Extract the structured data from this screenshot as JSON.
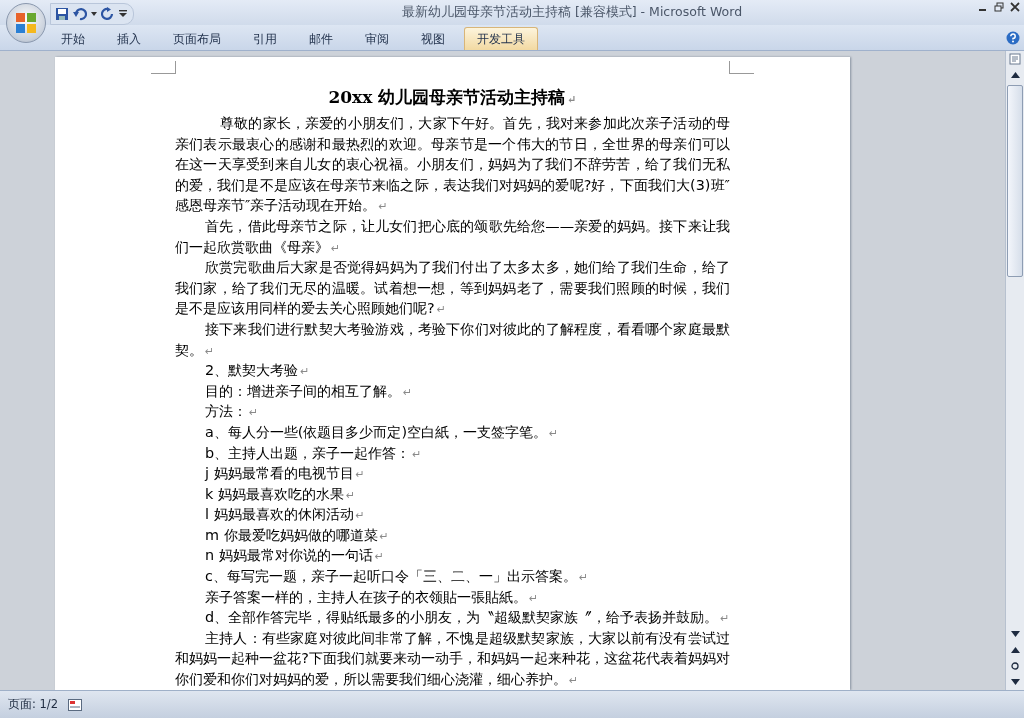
{
  "window": {
    "title": "最新幼儿园母亲节活动主持稿 [兼容模式] - Microsoft Word"
  },
  "tabs": [
    {
      "label": "开始",
      "selected": false
    },
    {
      "label": "插入",
      "selected": false
    },
    {
      "label": "页面布局",
      "selected": false
    },
    {
      "label": "引用",
      "selected": false
    },
    {
      "label": "邮件",
      "selected": false
    },
    {
      "label": "审阅",
      "selected": false
    },
    {
      "label": "视图",
      "selected": false
    },
    {
      "label": "开发工具",
      "selected": true
    }
  ],
  "document": {
    "title": "20xx 幼儿园母亲节活动主持稿",
    "paragraph_mark": "↵",
    "paragraphs": [
      {
        "kind": "body",
        "text": "尊敬的家长，亲爱的小朋友们，大家下午好。首先，我对来参加此次亲子活动的母亲们表示最衷心的感谢和最热烈的欢迎。母亲节是一个伟大的节日，全世界的母亲们可以在这一天享受到来自儿女的衷心祝福。小朋友们，妈妈为了我们不辞劳苦，给了我们无私的爱，我们是不是应该在母亲节来临之际，表达我们对妈妈的爱呢?好，下面我们大(3)班″感恩母亲节″亲子活动现在开始。",
        "first": true
      },
      {
        "kind": "body",
        "text": "首先，借此母亲节之际，让儿女们把心底的颂歌先给您——亲爱的妈妈。接下来让我们一起欣赏歌曲《母亲》"
      },
      {
        "kind": "body",
        "text": "欣赏完歌曲后大家是否觉得妈妈为了我们付出了太多太多，她们给了我们生命，给了我们家，给了我们无尽的温暖。试着想一想，等到妈妈老了，需要我们照顾的时候，我们是不是应该用同样的爱去关心照顾她们呢?"
      },
      {
        "kind": "body",
        "text": "接下来我们进行默契大考验游戏，考验下你们对彼此的了解程度，看看哪个家庭最默契。"
      },
      {
        "kind": "item",
        "text": "2、默契大考验"
      },
      {
        "kind": "item",
        "text": "目的：增进亲子间的相互了解。"
      },
      {
        "kind": "item",
        "text": "方法："
      },
      {
        "kind": "item",
        "text": "a、每人分一些(依题目多少而定)空白紙，一支签字笔。"
      },
      {
        "kind": "item",
        "text": "b、主持人出题，亲子一起作答："
      },
      {
        "kind": "item",
        "text": "j 妈妈最常看的电视节目"
      },
      {
        "kind": "item",
        "text": "k 妈妈最喜欢吃的水果"
      },
      {
        "kind": "item",
        "text": "l 妈妈最喜欢的休闲活动"
      },
      {
        "kind": "item",
        "text": "m 你最爱吃妈妈做的哪道菜"
      },
      {
        "kind": "item",
        "text": "n 妈妈最常对你说的一句话"
      },
      {
        "kind": "item",
        "text": "c、每写完一题，亲子一起听口令「三、二、一」出示答案。"
      },
      {
        "kind": "item",
        "text": "亲子答案一样的，主持人在孩子的衣领貼一張貼紙。"
      },
      {
        "kind": "item",
        "text": "d、全部作答完毕，得贴纸最多的小朋友，为〝超級默契家族〞，给予表扬并鼓励。"
      },
      {
        "kind": "body",
        "text": "主持人：有些家庭对彼此间非常了解，不愧是超级默契家族，大家以前有没有尝试过和妈妈一起种一盆花?下面我们就要来动一动手，和妈妈一起来种花，这盆花代表着妈妈对你们爱和你们对妈妈的爱，所以需要我们细心浇灌，细心养护。"
      }
    ]
  },
  "status_bar": {
    "page": "页面: 1/2"
  }
}
